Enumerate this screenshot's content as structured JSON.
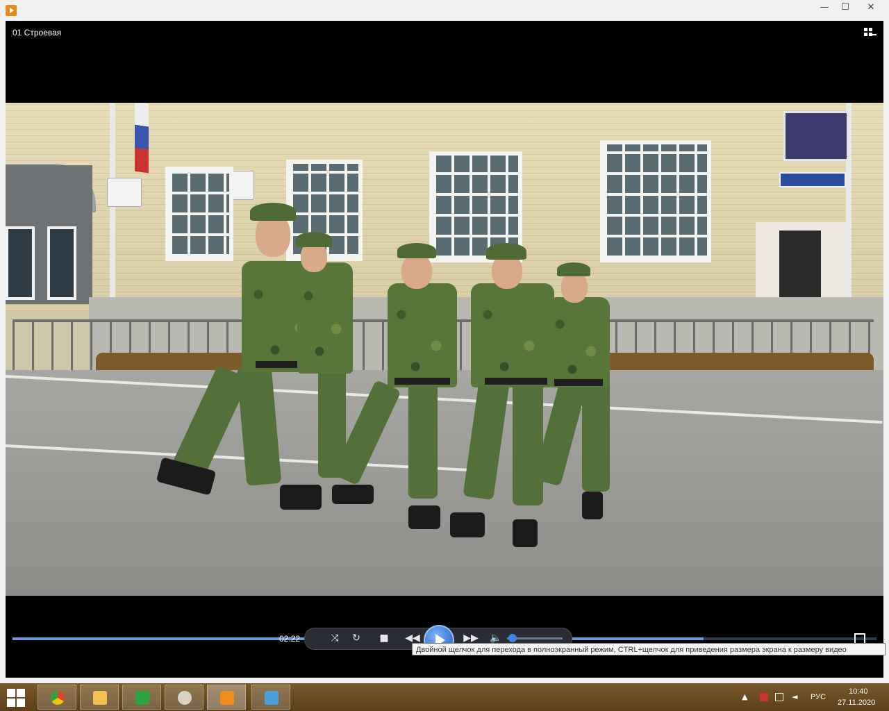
{
  "window": {
    "minimize_glyph": "—",
    "maximize_glyph": "☐",
    "close_glyph": "✕",
    "app_icon": "media-player-icon"
  },
  "player": {
    "video_title": "01 Строевая",
    "switch_icon": "switch-to-library-icon",
    "time": "02:22",
    "progress": 0.8,
    "volume": 0.1,
    "tooltip": "Двойной щелчок для перехода в полноэкранный режим, CTRL+щелчок для приведения размера экрана к размеру видео",
    "controls": {
      "shuffle_glyph": "⤨",
      "repeat_glyph": "↻",
      "stop_glyph": "■",
      "prev_glyph": "◀◀",
      "next_glyph": "▶▶",
      "mute_glyph": "🔈"
    }
  },
  "taskbar": {
    "apps": [
      {
        "name": "chrome-icon",
        "color": "#e0402d"
      },
      {
        "name": "file-explorer-icon",
        "color": "#f2c14e"
      },
      {
        "name": "store-icon",
        "color": "#2aa43f"
      },
      {
        "name": "paint-icon",
        "color": "#d9d2c3"
      },
      {
        "name": "media-player-icon",
        "color": "#f08c1e"
      },
      {
        "name": "photo-viewer-icon",
        "color": "#4aa0d8"
      }
    ],
    "tray": {
      "show_hidden_glyph": "▲",
      "language": "РУС",
      "time": "10:40",
      "date": "27.11.2020"
    }
  }
}
